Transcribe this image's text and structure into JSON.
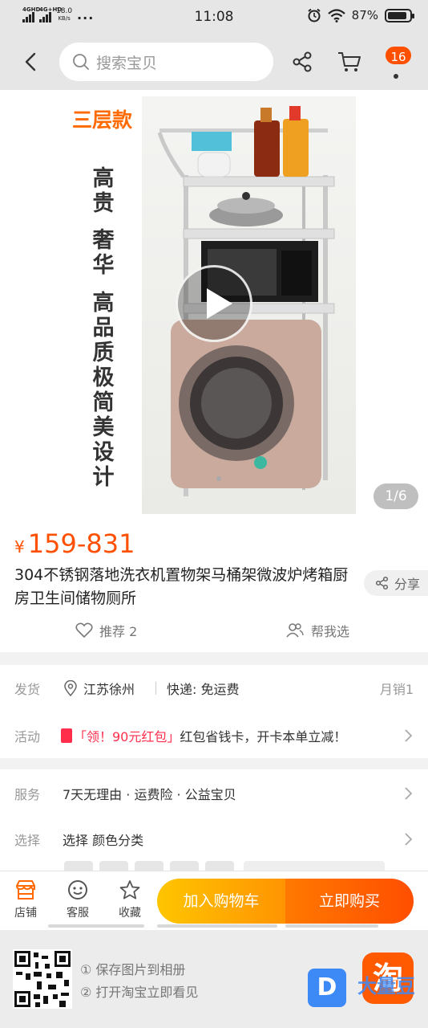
{
  "status_bar": {
    "signal1": "4GHD",
    "signal2": "4G+HD",
    "speed_value": "18.0",
    "speed_unit": "KB/s",
    "dots": "···",
    "time": "11:08",
    "battery": "87%",
    "battery_level": 0.87
  },
  "nav": {
    "search_placeholder": "搜索宝贝",
    "cart_badge": "16"
  },
  "gallery": {
    "badge_label": "三层款",
    "vertical_texts": [
      "高贵",
      "奢华",
      "高品质极简美设计"
    ],
    "pager": "1/6"
  },
  "product": {
    "price_symbol": "¥",
    "price_range": "159-831",
    "title": "304不锈钢落地洗衣机置物架马桶架微波炉烤箱厨房卫生间储物厕所",
    "share_label": "分享",
    "recommend_label": "推荐 2",
    "help_label": "帮我选"
  },
  "shipping": {
    "key": "发货",
    "location": "江苏徐州",
    "express": "快递: 免运费",
    "monthly_sales": "月销1"
  },
  "activity": {
    "key": "活动",
    "tag": "「领！90元红包」",
    "desc": "红包省钱卡，开卡本单立减！"
  },
  "service": {
    "key": "服务",
    "value": "7天无理由 · 运费险 · 公益宝贝"
  },
  "select": {
    "key": "选择",
    "value": "选择 颜色分类"
  },
  "actionbar": {
    "shop": "店铺",
    "service": "客服",
    "favorite": "收藏",
    "add_cart": "加入购物车",
    "buy_now": "立即购买"
  },
  "footer": {
    "step1": "① 保存图片到相册",
    "step2": "② 打开淘宝立即看见",
    "taobao_char": "淘",
    "d_char": "D",
    "watermark": "大量豆"
  }
}
